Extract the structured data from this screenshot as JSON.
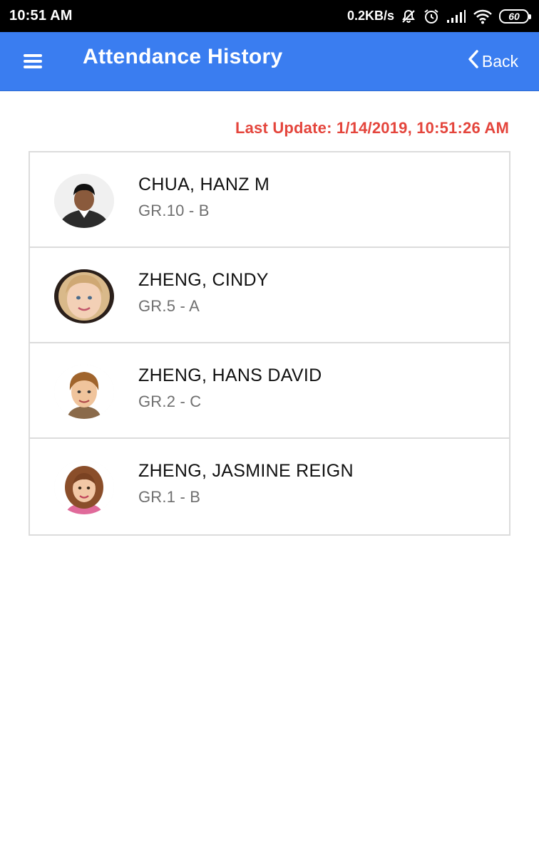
{
  "status_bar": {
    "time": "10:51 AM",
    "network_speed": "0.2KB/s",
    "battery": "60",
    "icons": [
      "mute-icon",
      "alarm-icon",
      "signal-icon",
      "wifi-icon",
      "battery-icon"
    ]
  },
  "app_bar": {
    "title": "Attendance History",
    "back_label": "Back",
    "color": "#3a7df0"
  },
  "last_update": "Last Update: 1/14/2019, 10:51:26 AM",
  "last_update_color": "#e4453c",
  "students": [
    {
      "name": "CHUA, HANZ M",
      "grade": "GR.10 - B"
    },
    {
      "name": "ZHENG, CINDY",
      "grade": "GR.5 - A"
    },
    {
      "name": "ZHENG, HANS DAVID",
      "grade": "GR.2 - C"
    },
    {
      "name": "ZHENG, JASMINE REIGN",
      "grade": "GR.1 - B"
    }
  ]
}
